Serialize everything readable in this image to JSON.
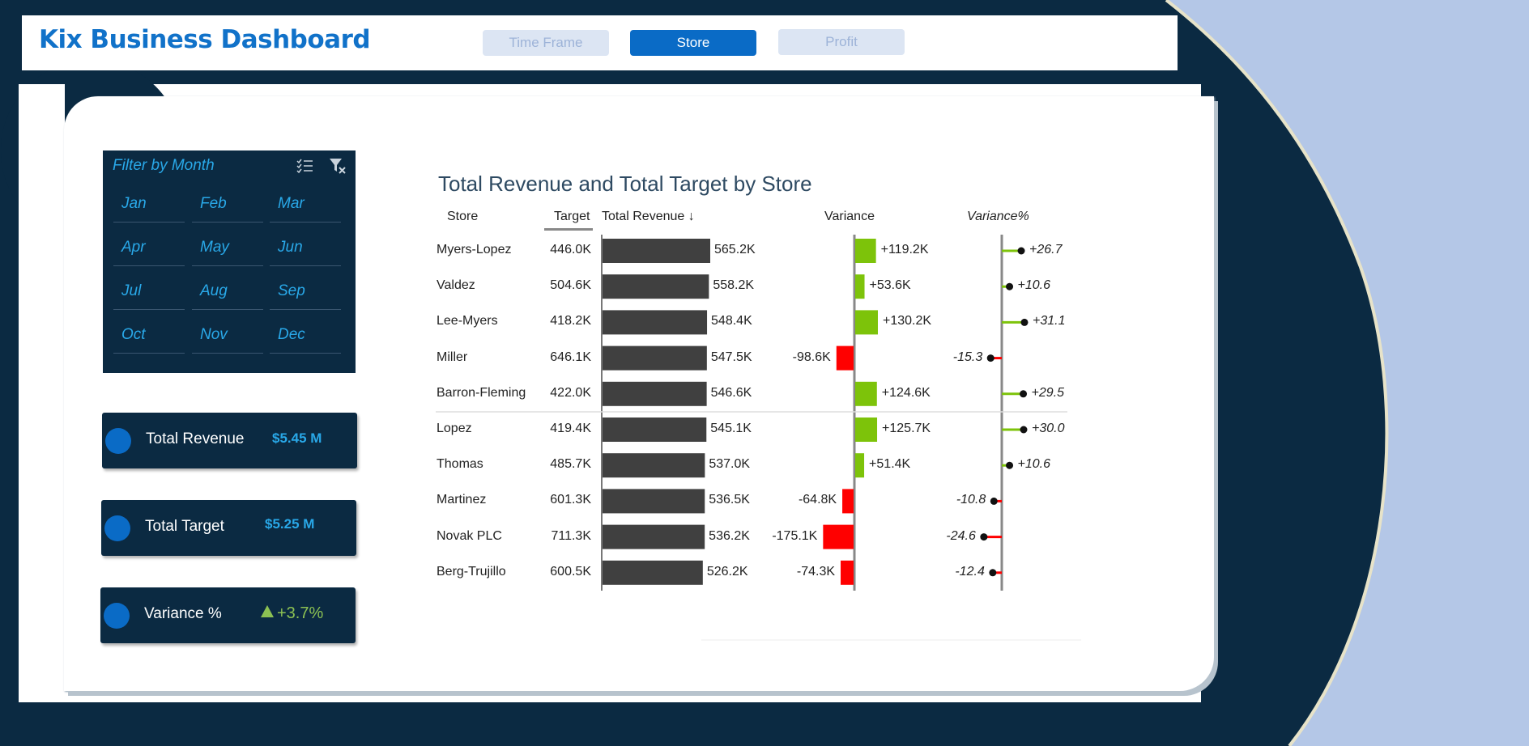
{
  "app": {
    "title": "Kix Business Dashboard"
  },
  "nav": {
    "tabs": [
      {
        "label": "Time Frame"
      },
      {
        "label": "Store"
      },
      {
        "label": "Profit"
      }
    ],
    "active": "Store"
  },
  "filter": {
    "title": "Filter by Month",
    "icons": [
      "select-all-icon",
      "clear-filter-icon"
    ],
    "months": [
      "Jan",
      "Feb",
      "Mar",
      "Apr",
      "May",
      "Jun",
      "Jul",
      "Aug",
      "Sep",
      "Oct",
      "Nov",
      "Dec"
    ]
  },
  "kpis": [
    {
      "label": "Total Revenue",
      "value": "$5.45 M"
    },
    {
      "label": "Total Target",
      "value": "$5.25 M"
    },
    {
      "label": "Variance %",
      "value": "+3.7%",
      "trend_icon": "triangle-up-icon"
    }
  ],
  "colors": {
    "brand": "#1172c9",
    "navy": "#0b2a42",
    "positive": "#7dc30a",
    "negative": "#ff0000",
    "bar": "#404040",
    "accent": "#29a8e8"
  },
  "chart_data": {
    "type": "table",
    "title": "Total Revenue and Total Target by Store",
    "columns": [
      "Store",
      "Target",
      "Total Revenue",
      "Variance",
      "Variance%"
    ],
    "sort": "Total Revenue descending",
    "rows": [
      {
        "store": "Myers-Lopez",
        "target": "446.0K",
        "revenue": "565.2K",
        "variance": "+119.2K",
        "variance_pct": "+26.7",
        "target_k": 446.0,
        "revenue_k": 565.2,
        "variance_k": 119.2,
        "variance_pct_num": 26.7
      },
      {
        "store": "Valdez",
        "target": "504.6K",
        "revenue": "558.2K",
        "variance": "+53.6K",
        "variance_pct": "+10.6",
        "target_k": 504.6,
        "revenue_k": 558.2,
        "variance_k": 53.6,
        "variance_pct_num": 10.6
      },
      {
        "store": "Lee-Myers",
        "target": "418.2K",
        "revenue": "548.4K",
        "variance": "+130.2K",
        "variance_pct": "+31.1",
        "target_k": 418.2,
        "revenue_k": 548.4,
        "variance_k": 130.2,
        "variance_pct_num": 31.1
      },
      {
        "store": "Miller",
        "target": "646.1K",
        "revenue": "547.5K",
        "variance": "-98.6K",
        "variance_pct": "-15.3",
        "target_k": 646.1,
        "revenue_k": 547.5,
        "variance_k": -98.6,
        "variance_pct_num": -15.3
      },
      {
        "store": "Barron-Fleming",
        "target": "422.0K",
        "revenue": "546.6K",
        "variance": "+124.6K",
        "variance_pct": "+29.5",
        "target_k": 422.0,
        "revenue_k": 546.6,
        "variance_k": 124.6,
        "variance_pct_num": 29.5
      },
      {
        "store": "Lopez",
        "target": "419.4K",
        "revenue": "545.1K",
        "variance": "+125.7K",
        "variance_pct": "+30.0",
        "target_k": 419.4,
        "revenue_k": 545.1,
        "variance_k": 125.7,
        "variance_pct_num": 30.0
      },
      {
        "store": "Thomas",
        "target": "485.7K",
        "revenue": "537.0K",
        "variance": "+51.4K",
        "variance_pct": "+10.6",
        "target_k": 485.7,
        "revenue_k": 537.0,
        "variance_k": 51.4,
        "variance_pct_num": 10.6
      },
      {
        "store": "Martinez",
        "target": "601.3K",
        "revenue": "536.5K",
        "variance": "-64.8K",
        "variance_pct": "-10.8",
        "target_k": 601.3,
        "revenue_k": 536.5,
        "variance_k": -64.8,
        "variance_pct_num": -10.8
      },
      {
        "store": "Novak PLC",
        "target": "711.3K",
        "revenue": "536.2K",
        "variance": "-175.1K",
        "variance_pct": "-24.6",
        "target_k": 711.3,
        "revenue_k": 536.2,
        "variance_k": -175.1,
        "variance_pct_num": -24.6
      },
      {
        "store": "Berg-Trujillo",
        "target": "600.5K",
        "revenue": "526.2K",
        "variance": "-74.3K",
        "variance_pct": "-12.4",
        "target_k": 600.5,
        "revenue_k": 526.2,
        "variance_k": -74.3,
        "variance_pct_num": -12.4
      }
    ]
  }
}
